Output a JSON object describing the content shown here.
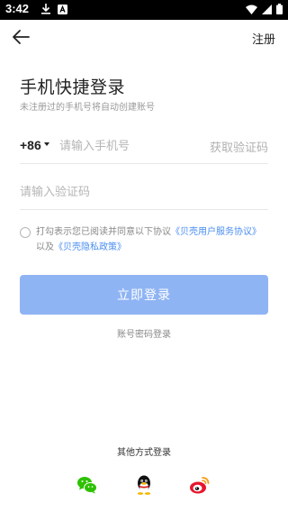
{
  "status_bar": {
    "time": "3:42"
  },
  "header": {
    "register_label": "注册"
  },
  "login": {
    "title": "手机快捷登录",
    "subtitle": "未注册过的手机号将自动创建账号",
    "country_code": "+86",
    "phone_placeholder": "请输入手机号",
    "get_code_label": "获取验证码",
    "code_placeholder": "请输入验证码",
    "agreement": {
      "prefix": "打勾表示您已阅读并同意以下协议",
      "service_link": "《贝壳用户服务协议》",
      "middle": "以及",
      "privacy_link": "《贝壳隐私政策》"
    },
    "login_button": "立即登录",
    "password_login": "账号密码登录"
  },
  "other_login": {
    "title": "其他方式登录",
    "methods": [
      "wechat-icon",
      "qq-icon",
      "weibo-icon"
    ]
  },
  "colors": {
    "accent": "#8fb4f4",
    "link": "#4a8df0"
  }
}
